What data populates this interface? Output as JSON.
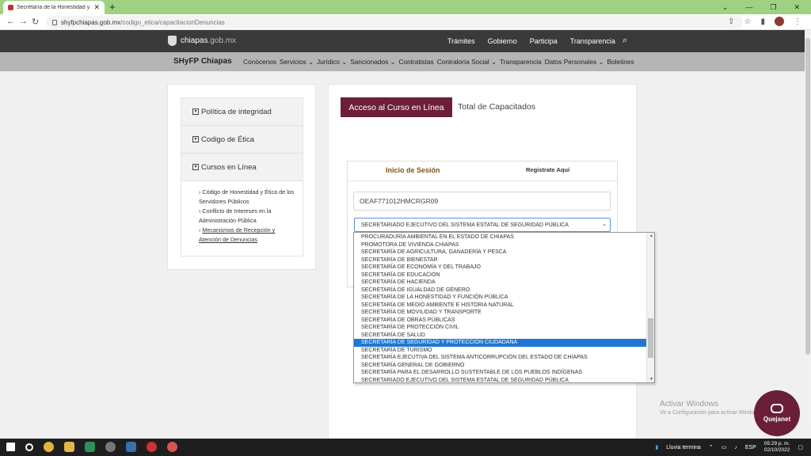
{
  "browser": {
    "tab_title": "Secretaría de la Honestidad y Fu",
    "url_host": "shyfpchiapas.gob.mx",
    "url_path": "/codigo_etica/capacitacionDenuncias"
  },
  "site": {
    "logo_main": "chiapas",
    "logo_suffix": ".gob.mx",
    "topnav": [
      "Trámites",
      "Gobierno",
      "Participa",
      "Transparencia"
    ],
    "brand": "SHyFP Chiapas",
    "subnav": [
      "Conócenos",
      "Servicios",
      "Jurídico",
      "Sancionados",
      "Contratistas",
      "Contraloría Social",
      "Transparencia",
      "Datos Personales",
      "Boletines"
    ]
  },
  "sidebar": {
    "items": [
      {
        "label": "Política de integridad"
      },
      {
        "label": "Codigo de Ética"
      },
      {
        "label": "Cursos en Línea"
      }
    ],
    "sublinks": [
      "Código de Honestidad y Ética de los Servidores Públicos",
      "Conflicto de Intereses en la Administración Pública",
      "Mecanismos de Recepción y Atención de Denuncias"
    ]
  },
  "main": {
    "primary_button": "Acceso al Curso en Línea",
    "secondary_button": "Total de Capacitados",
    "login_tab": "Inicio de Sesión",
    "register_tab": "Registrate Aquí",
    "curp_value": "OEAF771012HMCRGR09",
    "select_value": "SECRETARIADO EJECUTIVO DEL SISTEMA ESTATAL DE SEGURIDAD PÚBLICA",
    "selected_index": 14,
    "options": [
      "PROCURADURÍA AMBIENTAL EN EL ESTADO DE CHIAPAS",
      "PROMOTORA DE VIVIENDA CHIAPAS",
      "SECRETARÍA DE AGRICULTURA, GANADERÍA Y PESCA",
      "SECRETARÍA DE BIENESTAR",
      "SECRETARÍA DE ECONOMÍA Y DEL TRABAJO",
      "SECRETARÍA DE EDUCACIÓN",
      "SECRETARÍA DE HACIENDA",
      "SECRETARÍA DE IGUALDAD DE GÉNERO",
      "SECRETARÍA DE LA HONESTIDAD Y FUNCIÓN PÚBLICA",
      "SECRETARÍA DE MEDIO AMBIENTE E HISTORIA NATURAL",
      "SECRETARÍA DE MOVILIDAD Y TRANSPORTE",
      "SECRETARÍA DE OBRAS PÚBLICAS",
      "SECRETARÍA DE PROTECCIÓN CIVIL",
      "SECRETARÍA DE SALUD",
      "SECRETARÍA DE SEGURIDAD Y PROTECCIÓN CIUDADANA",
      "SECRETARÍA DE TURISMO",
      "SECRETARÍA EJECUTIVA DEL SISTEMA ANTICORRUPCIÓN DEL ESTADO DE CHIAPAS",
      "SECRETARÍA GENERAL DE GOBIERNO",
      "SECRETARÍA PARA EL DESARROLLO SUSTENTABLE DE LOS PUEBLOS INDÍGENAS",
      "SECRETARIADO EJECUTIVO DEL SISTEMA ESTATAL DE SEGURIDAD PÚBLICA"
    ]
  },
  "overlay": {
    "watermark_title": "Activar Windows",
    "watermark_sub": "Ve a Configuración para activar Windows.",
    "chat_label": "Quejanet"
  },
  "taskbar": {
    "weather": "Lluvia termina",
    "lang": "ESP",
    "time": "05:29 p. m.",
    "date": "02/10/2022"
  },
  "colors": {
    "brand_primary": "#6d1f3a",
    "selected_option": "#1e77d3",
    "tab_bar": "#9ed282"
  }
}
